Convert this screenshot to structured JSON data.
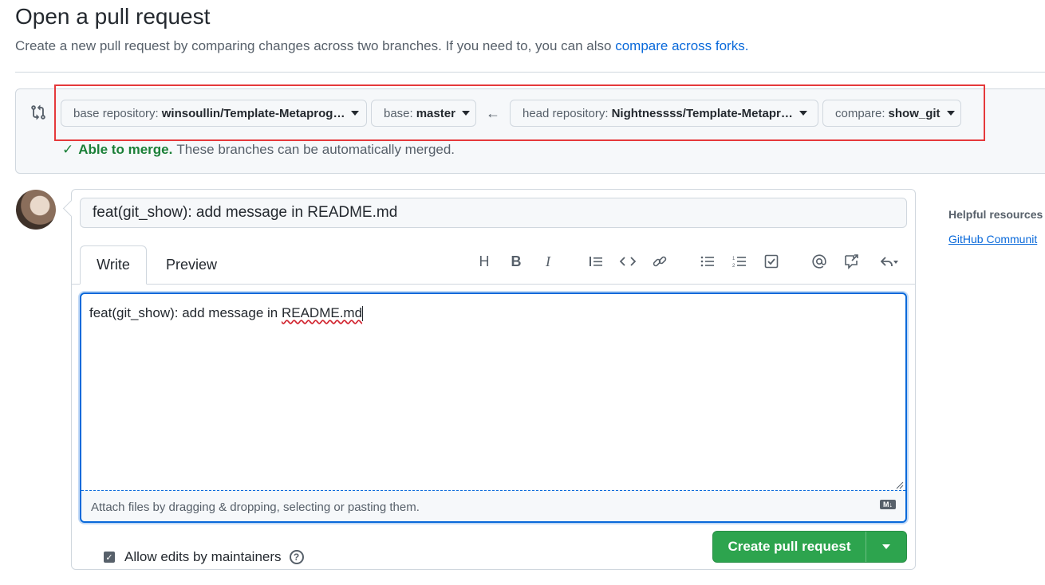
{
  "page": {
    "title": "Open a pull request",
    "subtitle_prefix": "Create a new pull request by comparing changes across two branches. If you need to, you can also ",
    "subtitle_link": "compare across forks."
  },
  "range": {
    "base_repo_label": "base repository:",
    "base_repo_value": "winsoullin/Template-Metaprog…",
    "base_label": "base:",
    "base_value": "master",
    "head_repo_label": "head repository:",
    "head_repo_value": "Nightnessss/Template-Metapr…",
    "compare_label": "compare:",
    "compare_value": "show_git",
    "merge_ok": "Able to merge.",
    "merge_msg": "These branches can be automatically merged."
  },
  "form": {
    "title_value": "feat(git_show): add message in README.md",
    "tab_write": "Write",
    "tab_preview": "Preview",
    "body_prefix": "feat(git_show): add message in ",
    "body_misspelled": "README.md",
    "attach_text": "Attach files by dragging & dropping, selecting or pasting them.",
    "markdown_badge": "M↓",
    "allow_edits": "Allow edits by maintainers",
    "create_button": "Create pull request"
  },
  "toolbar": {
    "heading": "H",
    "bold": "B",
    "italic": "I"
  },
  "sidebar": {
    "heading": "Helpful resources",
    "link": "GitHub Communit"
  },
  "colors": {
    "accent": "#0969da",
    "success": "#2da44e",
    "highlight": "#e5393b"
  }
}
